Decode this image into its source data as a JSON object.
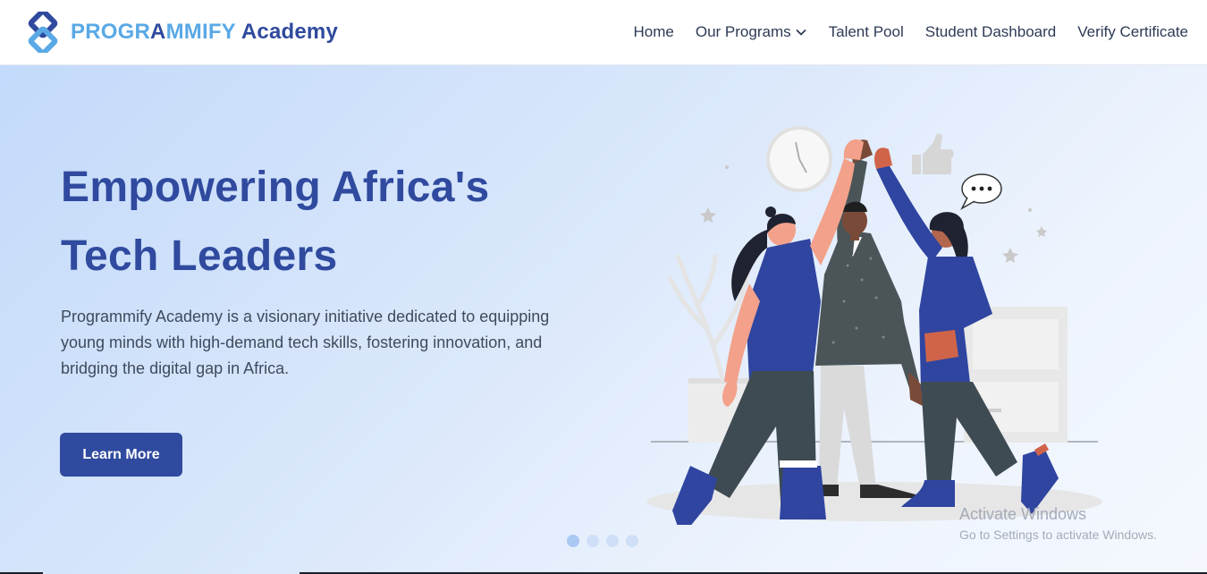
{
  "brand": {
    "name_parts": [
      "PROGR",
      "A",
      "MMIFY",
      "Academy"
    ],
    "logo_icon": "diamond-chain-logo",
    "colors": {
      "primary": "#2f4a9e",
      "light": "#5aa9e6"
    }
  },
  "nav": {
    "items": [
      {
        "label": "Home"
      },
      {
        "label": "Our Programs",
        "icon": "chevron-down-icon"
      },
      {
        "label": "Talent Pool"
      },
      {
        "label": "Student Dashboard"
      },
      {
        "label": "Verify Certificate"
      }
    ]
  },
  "hero": {
    "title_line1": "Empowering Africa's",
    "title_line2": "Tech Leaders",
    "description": "Programmify Academy is a visionary initiative dedicated to equipping young minds with high-demand tech skills, fostering innovation, and bridging the digital gap in Africa.",
    "cta_label": "Learn More",
    "illustration": "team-high-five-illustration"
  },
  "carousel": {
    "slide_count": 4,
    "active_index": 0
  },
  "watermark": {
    "title": "Activate Windows",
    "subtitle": "Go to Settings to activate Windows."
  }
}
